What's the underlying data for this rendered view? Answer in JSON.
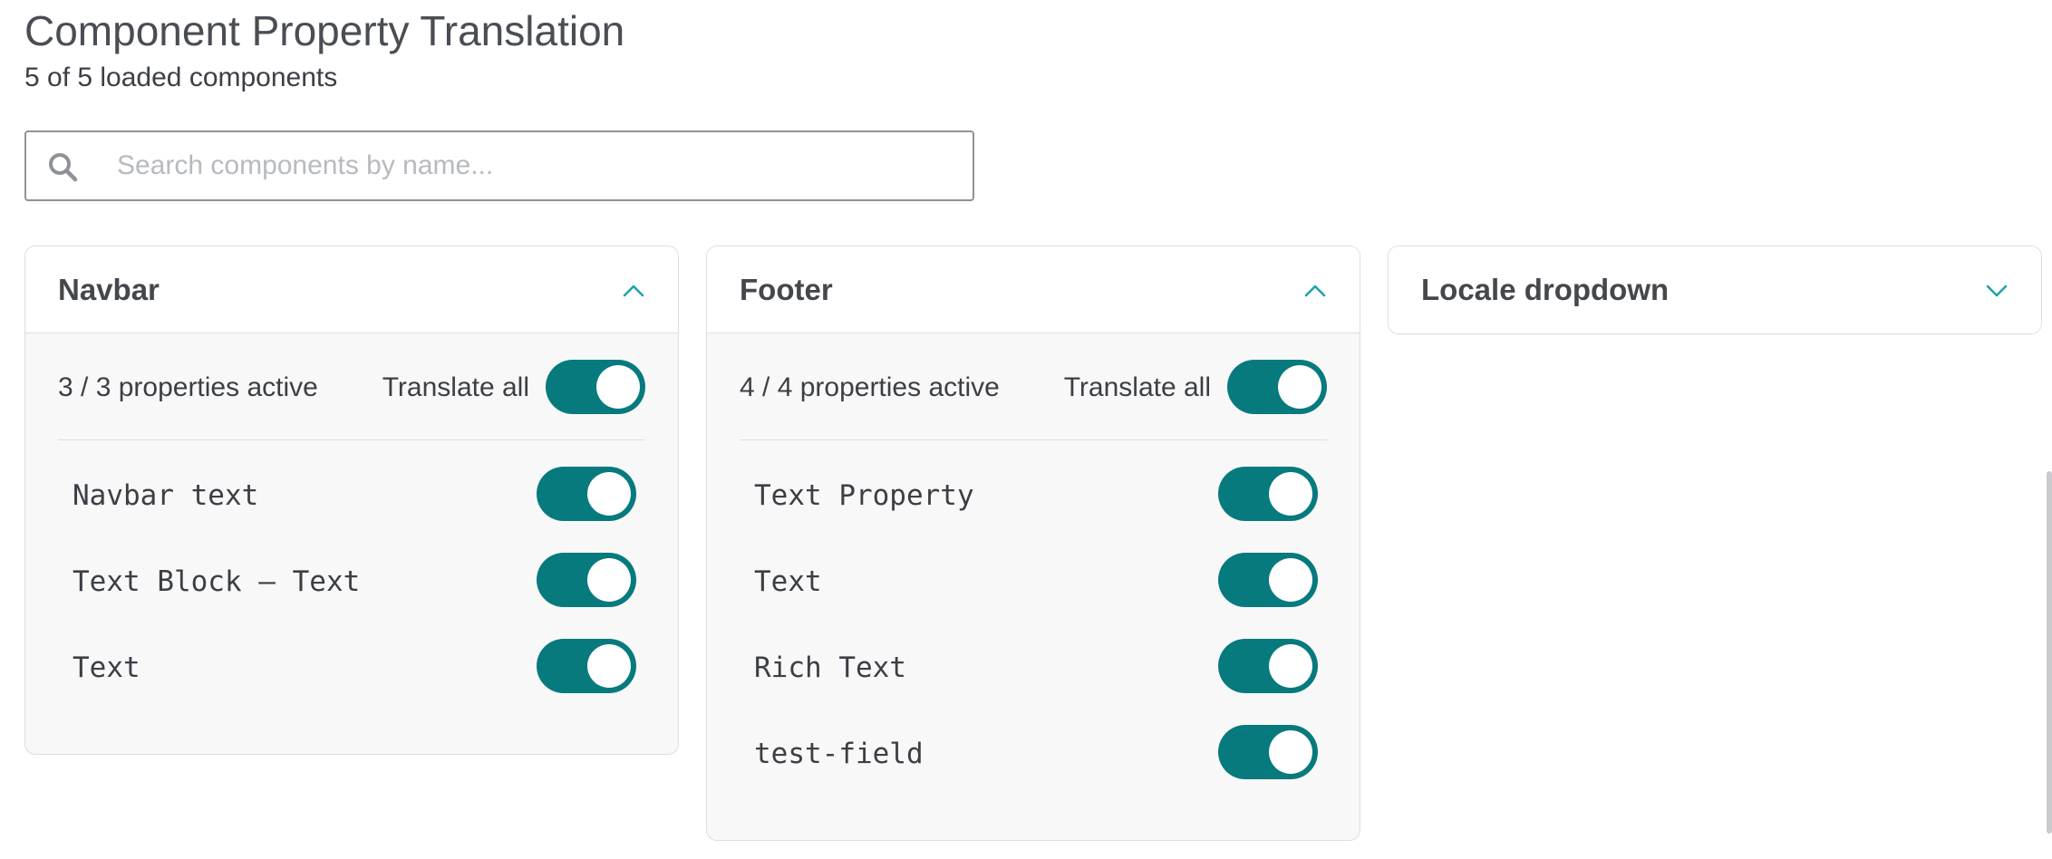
{
  "header": {
    "title": "Component Property Translation",
    "subtitle": "5 of 5 loaded components"
  },
  "search": {
    "placeholder": "Search components by name...",
    "value": "",
    "icon": "search-icon"
  },
  "colors": {
    "toggle_on": "#077a7e",
    "chevron": "#1fa3a8"
  },
  "cards": [
    {
      "title": "Navbar",
      "expanded": true,
      "summary": "3 / 3 properties active",
      "translate_all_label": "Translate all",
      "translate_all_on": true,
      "properties": [
        {
          "label": "Navbar text",
          "on": true
        },
        {
          "label": "Text Block – Text",
          "on": true
        },
        {
          "label": "Text",
          "on": true
        }
      ]
    },
    {
      "title": "Footer",
      "expanded": true,
      "summary": "4 / 4 properties active",
      "translate_all_label": "Translate all",
      "translate_all_on": true,
      "properties": [
        {
          "label": "Text Property",
          "on": true
        },
        {
          "label": "Text",
          "on": true
        },
        {
          "label": "Rich Text",
          "on": true
        },
        {
          "label": "test-field",
          "on": true
        }
      ]
    },
    {
      "title": "Locale dropdown",
      "expanded": false
    }
  ]
}
